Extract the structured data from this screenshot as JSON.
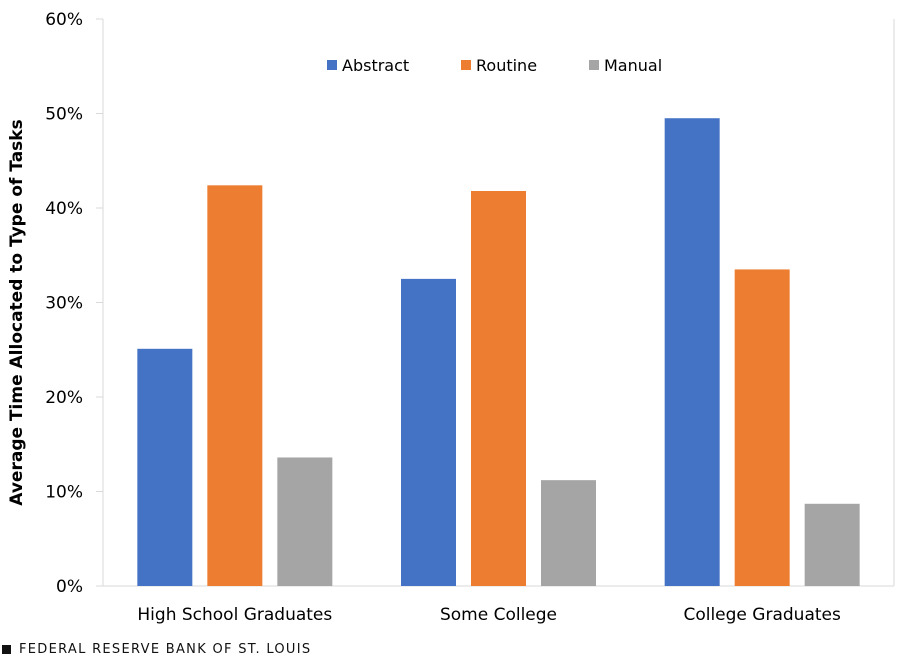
{
  "chart_data": {
    "type": "bar",
    "title": "",
    "xlabel": "",
    "ylabel": "Average Time Allocated to Type of Tasks",
    "ylim": [
      0,
      60
    ],
    "yticks": [
      0,
      10,
      20,
      30,
      40,
      50,
      60
    ],
    "ytick_labels": [
      "0%",
      "10%",
      "20%",
      "30%",
      "40%",
      "50%",
      "60%"
    ],
    "grid": false,
    "legend_position": "top-center",
    "categories": [
      "High School Graduates",
      "Some College",
      "College Graduates"
    ],
    "series": [
      {
        "name": "Abstract",
        "color": "#4472C4",
        "values": [
          25.1,
          32.5,
          49.5
        ]
      },
      {
        "name": "Routine",
        "color": "#ED7D31",
        "values": [
          42.4,
          41.8,
          33.5
        ]
      },
      {
        "name": "Manual",
        "color": "#A5A5A5",
        "values": [
          13.6,
          11.2,
          8.7
        ]
      }
    ]
  },
  "footer": {
    "source": "FEDERAL RESERVE BANK OF ST. LOUIS"
  }
}
